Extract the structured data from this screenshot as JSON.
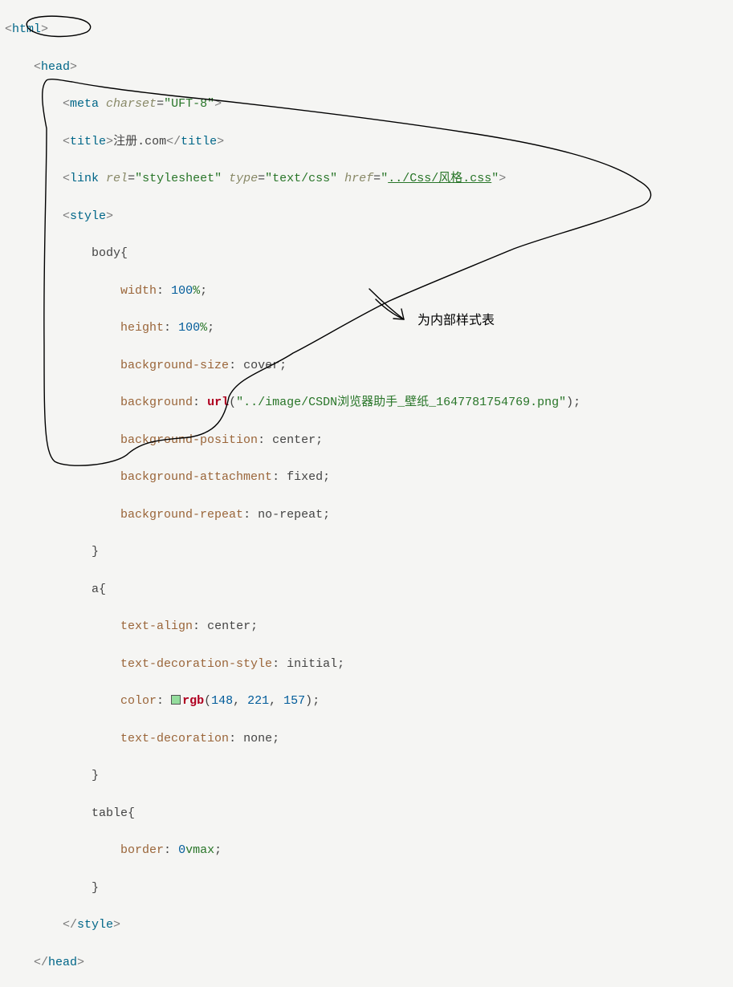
{
  "code": {
    "l01_open": "<html>",
    "l02_indent": "    ",
    "l02_open": "<head>",
    "l03_indent": "        ",
    "l03_open": "<meta",
    "l03_attr1_name": " charset",
    "l03_eq": "=",
    "l03_attr1_val": "\"UFT-8\"",
    "l03_close": ">",
    "l04_indent": "        ",
    "l04_open": "<title>",
    "l04_text": "注册.com",
    "l04_close": "</title>",
    "l05_indent": "        ",
    "l05_open": "<link",
    "l05_a1n": " rel",
    "l05_a1v": "\"stylesheet\"",
    "l05_a2n": " type",
    "l05_a2v": "\"text/css\"",
    "l05_a3n": " href",
    "l05_a3v": "\"",
    "l05_a3vu": "../Css/风格.css",
    "l05_a3ve": "\"",
    "l05_close": ">",
    "l06_indent": "        ",
    "l06_open": "<style>",
    "l07_indent": "            ",
    "l07_sel": "body",
    "l07_brace": "{",
    "p_width_i": "                ",
    "p_width_k": "width",
    "p_width_c": ": ",
    "p_width_v": "100",
    "p_width_u": "%",
    "p_width_e": ";",
    "p_height_i": "                ",
    "p_height_k": "height",
    "p_height_c": ": ",
    "p_height_v": "100",
    "p_height_u": "%",
    "p_height_e": ";",
    "p_bgsize_i": "                ",
    "p_bgsize_k": "background-size",
    "p_bgsize_c": ": ",
    "p_bgsize_v": "cover",
    "p_bgsize_e": ";",
    "p_bg_i": "                ",
    "p_bg_k": "background",
    "p_bg_c": ": ",
    "p_bg_fn": "url",
    "p_bg_p": "(",
    "p_bg_str": "\"../image/CSDN浏览器助手_壁纸_1647781754769.png\"",
    "p_bg_p2": ")",
    "p_bg_e": ";",
    "p_bgpos_i": "                ",
    "p_bgpos_k": "background-position",
    "p_bgpos_c": ": ",
    "p_bgpos_v": "center",
    "p_bgpos_e": ";",
    "p_bgatt_i": "                ",
    "p_bgatt_k": "background-attachment",
    "p_bgatt_c": ": ",
    "p_bgatt_v": "fixed",
    "p_bgatt_e": ";",
    "p_bgrep_i": "                ",
    "p_bgrep_k": "background-repeat",
    "p_bgrep_c": ": ",
    "p_bgrep_v": "no-repeat",
    "p_bgrep_e": ";",
    "l15_indent": "            ",
    "l15_brace": "}",
    "l16_indent": "            ",
    "l16_sel": "a",
    "l16_brace": "{",
    "p_ta_i": "                ",
    "p_ta_k": "text-align",
    "p_ta_c": ": ",
    "p_ta_v": "center",
    "p_ta_e": ";",
    "p_tds_i": "                ",
    "p_tds_k": "text-decoration-style",
    "p_tds_c": ": ",
    "p_tds_v": "initial",
    "p_tds_e": ";",
    "p_col_i": "                ",
    "p_col_k": "color",
    "p_col_c": ": ",
    "p_col_fn": "rgb",
    "p_col_p": "(",
    "p_col_r": "148",
    "p_col_s1": ", ",
    "p_col_g": "221",
    "p_col_s2": ", ",
    "p_col_b": "157",
    "p_col_p2": ")",
    "p_col_e": ";",
    "p_td_i": "                ",
    "p_td_k": "text-decoration",
    "p_td_c": ": ",
    "p_td_v": "none",
    "p_td_e": ";",
    "l21_indent": "            ",
    "l21_brace": "}",
    "l22_indent": "            ",
    "l22_sel": "table",
    "l22_brace": "{",
    "p_bor_i": "                ",
    "p_bor_k": "border",
    "p_bor_c": ": ",
    "p_bor_v": "0",
    "p_bor_u": "vmax",
    "p_bor_e": ";",
    "l24_indent": "            ",
    "l24_brace": "}",
    "l25_indent": "        ",
    "l25_close": "</style>",
    "l26_indent": "    ",
    "l26_close": "</head>"
  },
  "annotation": {
    "label": "为内部样式表"
  }
}
